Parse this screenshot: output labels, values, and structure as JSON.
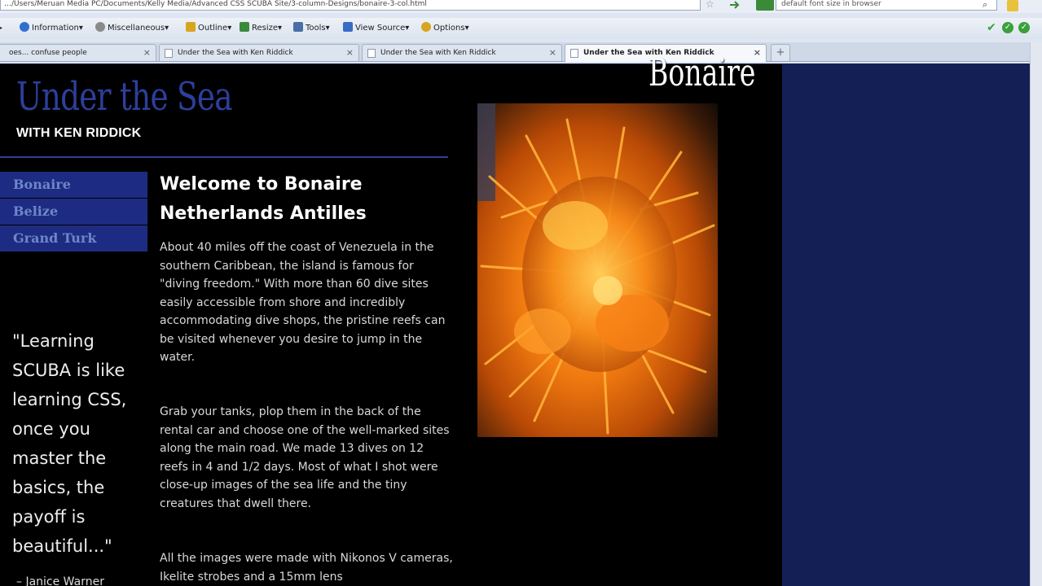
{
  "browser": {
    "url": "…/Users/Meruan Media PC/Documents/Kelly Media/Advanced CSS SCUBA Site/3-column-Designs/bonaire-3-col.html",
    "search_text": "default font size in browser",
    "devbar": [
      {
        "label": "Information",
        "icon": "info-icon",
        "color": "#2f6fd0"
      },
      {
        "label": "Miscellaneous",
        "icon": "misc-icon",
        "color": "#8a8a8a"
      },
      {
        "label": "Outline",
        "icon": "pencil-icon",
        "color": "#d8a520"
      },
      {
        "label": "Resize",
        "icon": "resize-icon",
        "color": "#3a8a3a"
      },
      {
        "label": "Tools",
        "icon": "wrench-icon",
        "color": "#4a6fa8"
      },
      {
        "label": "View Source",
        "icon": "view-source-icon",
        "color": "#3a6cc4"
      },
      {
        "label": "Options",
        "icon": "options-icon",
        "color": "#d8a520"
      }
    ],
    "tabs": [
      {
        "label": "oes... confuse people",
        "active": false
      },
      {
        "label": "Under the Sea with Ken Riddick",
        "active": false
      },
      {
        "label": "Under the Sea with Ken Riddick",
        "active": false
      },
      {
        "label": "Under the Sea with Ken Riddick",
        "active": true
      }
    ]
  },
  "site": {
    "title": "Under the Sea",
    "subtitle": "WITH KEN RIDDICK",
    "nav": [
      "Bonaire",
      "Belize",
      "Grand Turk"
    ],
    "quote": "\"Learning SCUBA is like learning CSS, once you master the basics, the payoff is beautiful...\"",
    "quote_author": "– Janice Warner",
    "heading": "Welcome to Bonaire Netherlands Antilles",
    "paragraphs": [
      "About 40 miles off the coast of Venezuela in the southern Caribbean, the island is famous for \"diving freedom.\" With more than 60 dive sites easily accessible from shore and incredibly accommodating dive shops, the pristine reefs can be visited whenever you desire to jump in the water.",
      "Grab your tanks, plop them in the back of the rental car and choose one of the well-marked sites along the main road. We made 13 dives on 12 reefs in 4 and 1/2 days. Most of what I shot were close-up images of the sea life and the tiny creatures that dwell there.",
      "All the images were made with Nikonos V cameras, Ikelite strobes and a 15mm lens"
    ],
    "photo_label": "Bonaire"
  },
  "colors": {
    "page_bg": "#000000",
    "title_blue": "#2d3f9c",
    "nav_bg": "#1d2c82",
    "outer_bg": "#141f55"
  }
}
